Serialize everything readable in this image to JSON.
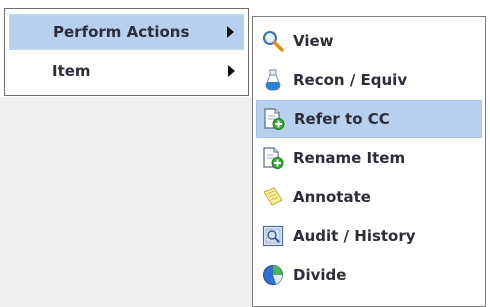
{
  "parent_menu": {
    "items": [
      {
        "label": "Perform Actions",
        "has_submenu": true,
        "active": true
      },
      {
        "label": "Item",
        "has_submenu": true,
        "active": false
      }
    ]
  },
  "submenu": {
    "items": [
      {
        "label": "View",
        "icon": "magnifier-icon"
      },
      {
        "label": "Recon / Equiv",
        "icon": "flask-icon"
      },
      {
        "label": "Refer to CC",
        "icon": "document-add-icon",
        "active": true
      },
      {
        "label": "Rename Item",
        "icon": "document-add-icon"
      },
      {
        "label": "Annotate",
        "icon": "notepad-icon"
      },
      {
        "label": "Audit / History",
        "icon": "audit-image-icon"
      },
      {
        "label": "Divide",
        "icon": "pie-chart-icon"
      }
    ]
  },
  "colors": {
    "highlight": "#b7d0ee",
    "text": "#2d2d3a",
    "border": "#6d6d6d"
  }
}
